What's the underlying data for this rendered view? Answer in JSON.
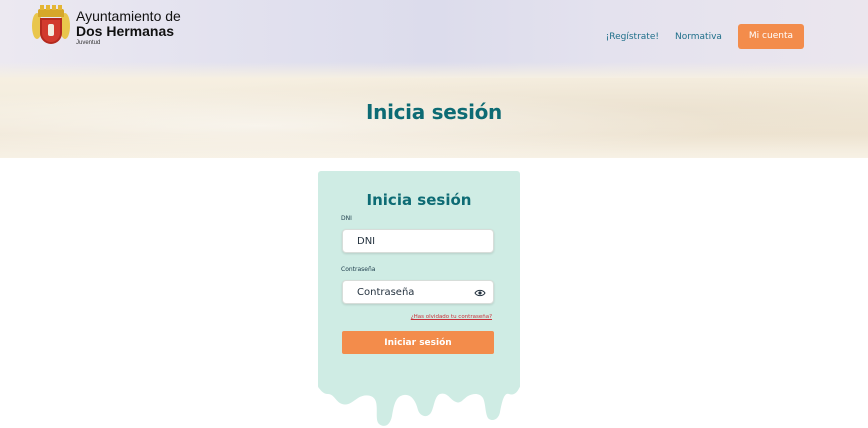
{
  "header": {
    "logo": {
      "line1": "Ayuntamiento de",
      "line2": "Dos Hermanas",
      "line3": "Juventud"
    },
    "nav": {
      "register_label": "¡Regístrate!",
      "normativa_label": "Normativa",
      "account_label": "Mi cuenta"
    }
  },
  "hero": {
    "title": "Inicia sesión"
  },
  "login_form": {
    "title": "Inicia sesión",
    "dni_label": "DNI",
    "dni_placeholder": "DNI",
    "password_label": "Contraseña",
    "password_placeholder": "Contraseña",
    "forgot_link": "¿Has olvidado tu contraseña?",
    "submit_label": "Iniciar sesión"
  },
  "colors": {
    "brand_teal": "#0d6b74",
    "accent_orange": "#f38c4b",
    "card_mint": "#cfece4",
    "link_red": "#c8323a",
    "nav_link": "#1f6f8a"
  },
  "icons": {
    "password_toggle": "eye-icon",
    "logo": "coat-of-arms-icon"
  }
}
